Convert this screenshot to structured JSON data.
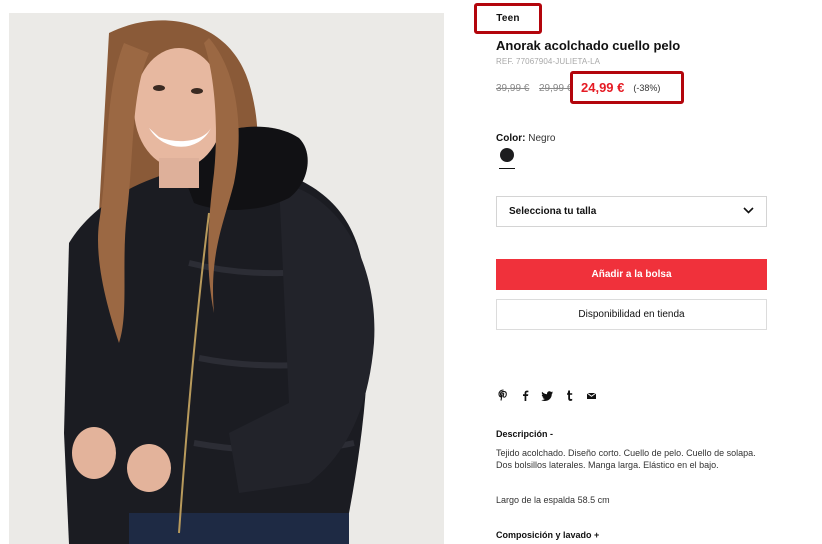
{
  "product": {
    "badge": "Teen",
    "title": "Anorak acolchado cuello pelo",
    "ref": "REF. 77067904-JULIETA-LA",
    "old_price_1": "39,99 €",
    "old_price_2": "29,99 €",
    "price": "24,99 €",
    "discount": "(-38%)",
    "color_label": "Color:",
    "color_value": "Negro",
    "swatch_color": "#1d1d1f"
  },
  "size": {
    "placeholder": "Selecciona tu talla",
    "icon": "chevron-down-icon"
  },
  "actions": {
    "add_to_bag": "Añadir a la bolsa",
    "store_availability": "Disponibilidad en tienda",
    "accent": "#f0313b"
  },
  "share_icons": [
    "pinterest-icon",
    "facebook-icon",
    "twitter-icon",
    "tumblr-icon",
    "mail-icon"
  ],
  "description": {
    "heading": "Descripción",
    "toggle": "-",
    "text": "Tejido acolchado. Diseño corto. Cuello de pelo. Cuello de solapa. Dos bolsillos laterales. Manga larga. Elástico en el bajo.",
    "length": "Largo de la espalda 58.5 cm"
  },
  "composition": {
    "heading": "Composición y lavado",
    "toggle": "+"
  },
  "highlight_color": "#b3050c"
}
